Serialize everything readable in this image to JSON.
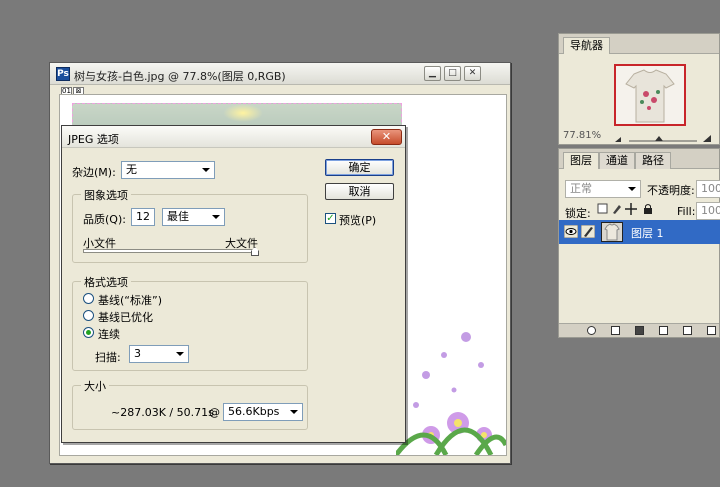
{
  "document": {
    "title": "树与女孩-白色.jpg @ 77.8%(图层 0,RGB)",
    "tab_icons": [
      "01",
      "⊠"
    ]
  },
  "dialog": {
    "title": "JPEG 选项",
    "close": "✕",
    "matte_label": "杂边(M):",
    "matte_value": "无",
    "image_options": {
      "legend": "图象选项",
      "quality_label": "品质(Q):",
      "quality_value": "12",
      "quality_preset": "最佳",
      "small_file": "小文件",
      "large_file": "大文件",
      "quality_level": 1.0
    },
    "format_options": {
      "legend": "格式选项",
      "baseline_standard": "基线(“标准”)",
      "baseline_optimized": "基线已优化",
      "progressive": "连续",
      "scans_label": "扫描:",
      "scans_value": "3",
      "selected": "progressive"
    },
    "size": {
      "legend": "大小",
      "estimate": "~287.03K / 50.71s",
      "at": "@",
      "speed": "56.6Kbps"
    },
    "ok_label": "确定",
    "cancel_label": "取消",
    "preview_label": "预览(P)",
    "preview_checked": true
  },
  "navigator": {
    "tab": "导航器",
    "zoom": "77.81%"
  },
  "layers": {
    "tabs": [
      "图层",
      "通道",
      "路径"
    ],
    "blend_mode": "正常",
    "opacity_label": "不透明度:",
    "opacity_value": "100",
    "lock_label": "锁定:",
    "fill_label": "Fill:",
    "fill_value": "100",
    "layer_name": "图层 1"
  },
  "colors": {
    "desktop": "#7a7a7a",
    "dialog_bg": "#ece9d8",
    "selection": "#316ac5",
    "close_red": "#c64c2b"
  }
}
